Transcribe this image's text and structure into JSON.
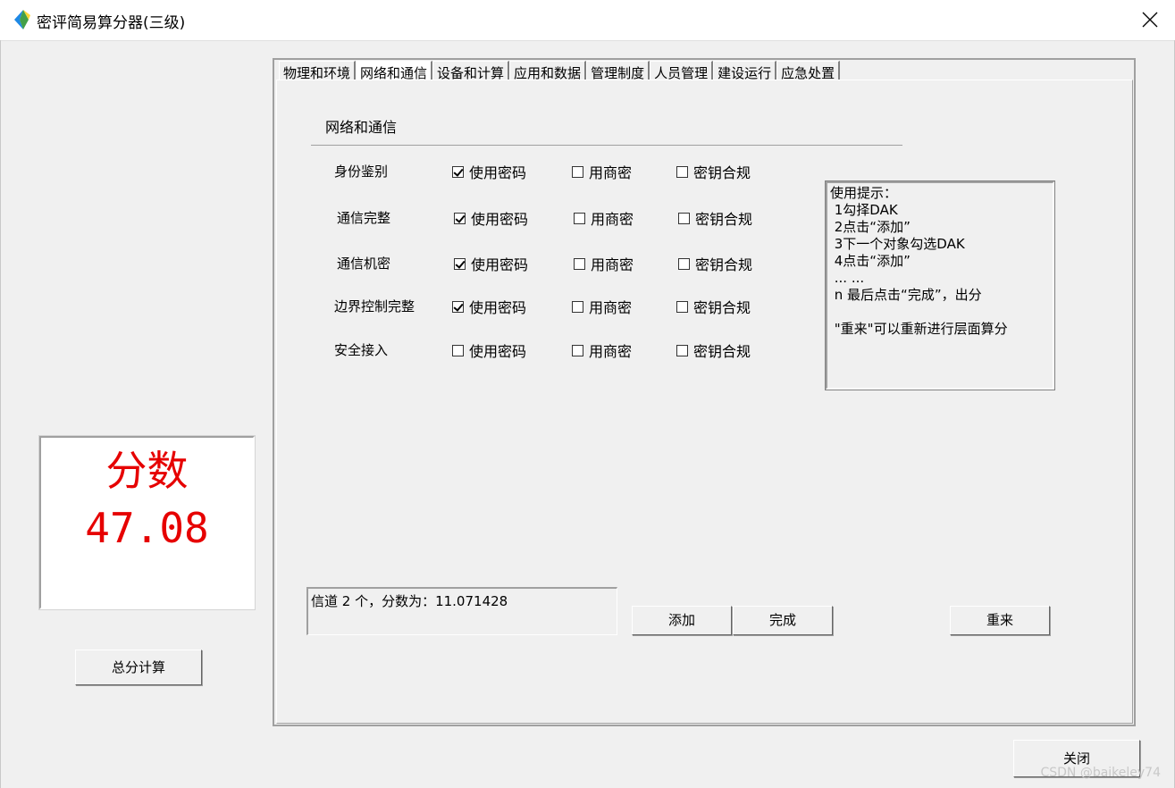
{
  "window": {
    "title": "密评简易算分器(三级)"
  },
  "score": {
    "label": "分数",
    "value": "47.08"
  },
  "buttons": {
    "total": "总分计算",
    "add": "添加",
    "finish": "完成",
    "reset": "重来",
    "close": "关闭"
  },
  "tabs": [
    "物理和环境",
    "网络和通信",
    "设备和计算",
    "应用和数据",
    "管理制度",
    "人员管理",
    "建设运行",
    "应急处置"
  ],
  "section": {
    "title": "网络和通信"
  },
  "option_labels": {
    "use_crypto": "使用密码",
    "commercial": "用商密",
    "key_compliance": "密钥合规"
  },
  "rows": [
    {
      "label": "身份鉴别",
      "use_crypto": true,
      "commercial": false,
      "key_compliance": false
    },
    {
      "label": "通信完整",
      "use_crypto": true,
      "commercial": false,
      "key_compliance": false
    },
    {
      "label": "通信机密",
      "use_crypto": true,
      "commercial": false,
      "key_compliance": false
    },
    {
      "label": "边界控制完整",
      "use_crypto": true,
      "commercial": false,
      "key_compliance": false
    },
    {
      "label": "安全接入",
      "use_crypto": false,
      "commercial": false,
      "key_compliance": false
    }
  ],
  "hint": {
    "lines": [
      "使用提示：",
      " 1勾择DAK",
      " 2点击“添加”",
      " 3下一个对象勾选DAK",
      " 4点击“添加”",
      " ... ...",
      " n 最后点击“完成”，出分",
      "",
      " \"重来\"可以重新进行层面算分"
    ]
  },
  "status": {
    "text": "信道 2 个，分数为：11.071428"
  },
  "watermark": "CSDN @baikeley74"
}
